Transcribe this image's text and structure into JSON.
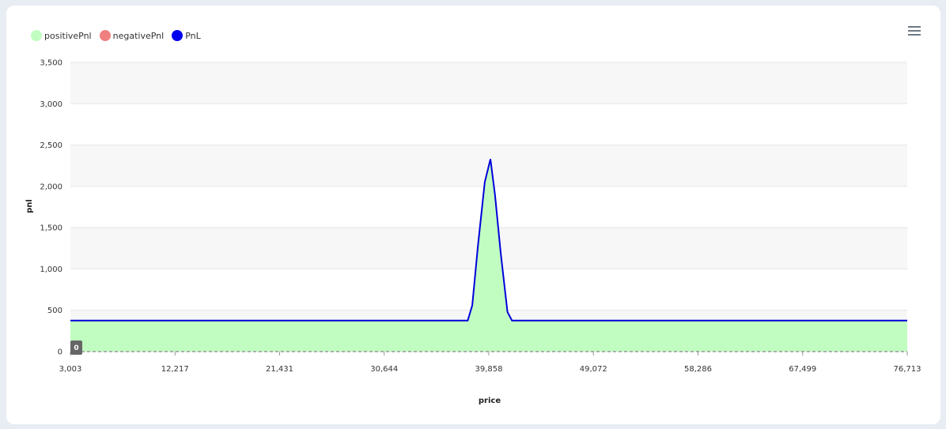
{
  "chart_data": {
    "type": "area",
    "xlabel": "price",
    "ylabel": "pnl",
    "x_ticks": [
      "3,003",
      "12,217",
      "21,431",
      "30,644",
      "39,858",
      "49,072",
      "58,286",
      "67,499",
      "76,713"
    ],
    "y_ticks": [
      "0",
      "500",
      "1,000",
      "1,500",
      "2,000",
      "2,500",
      "3,000",
      "3,500"
    ],
    "xlim": [
      3003,
      76713
    ],
    "ylim": [
      0,
      3500
    ],
    "zero_marker": "0",
    "legend_position": "top-left",
    "grid": true,
    "series": [
      {
        "name": "positivePnl",
        "color": "#c1fdc1"
      },
      {
        "name": "negativePnl",
        "color": "#f08080"
      },
      {
        "name": "PnL",
        "color": "#0000dd",
        "x": [
          3003,
          38000,
          38400,
          38900,
          39500,
          40000,
          40400,
          40900,
          41500,
          41900,
          76713
        ],
        "y": [
          375,
          375,
          560,
          1280,
          2050,
          2330,
          1900,
          1200,
          480,
          375,
          375
        ]
      }
    ]
  }
}
